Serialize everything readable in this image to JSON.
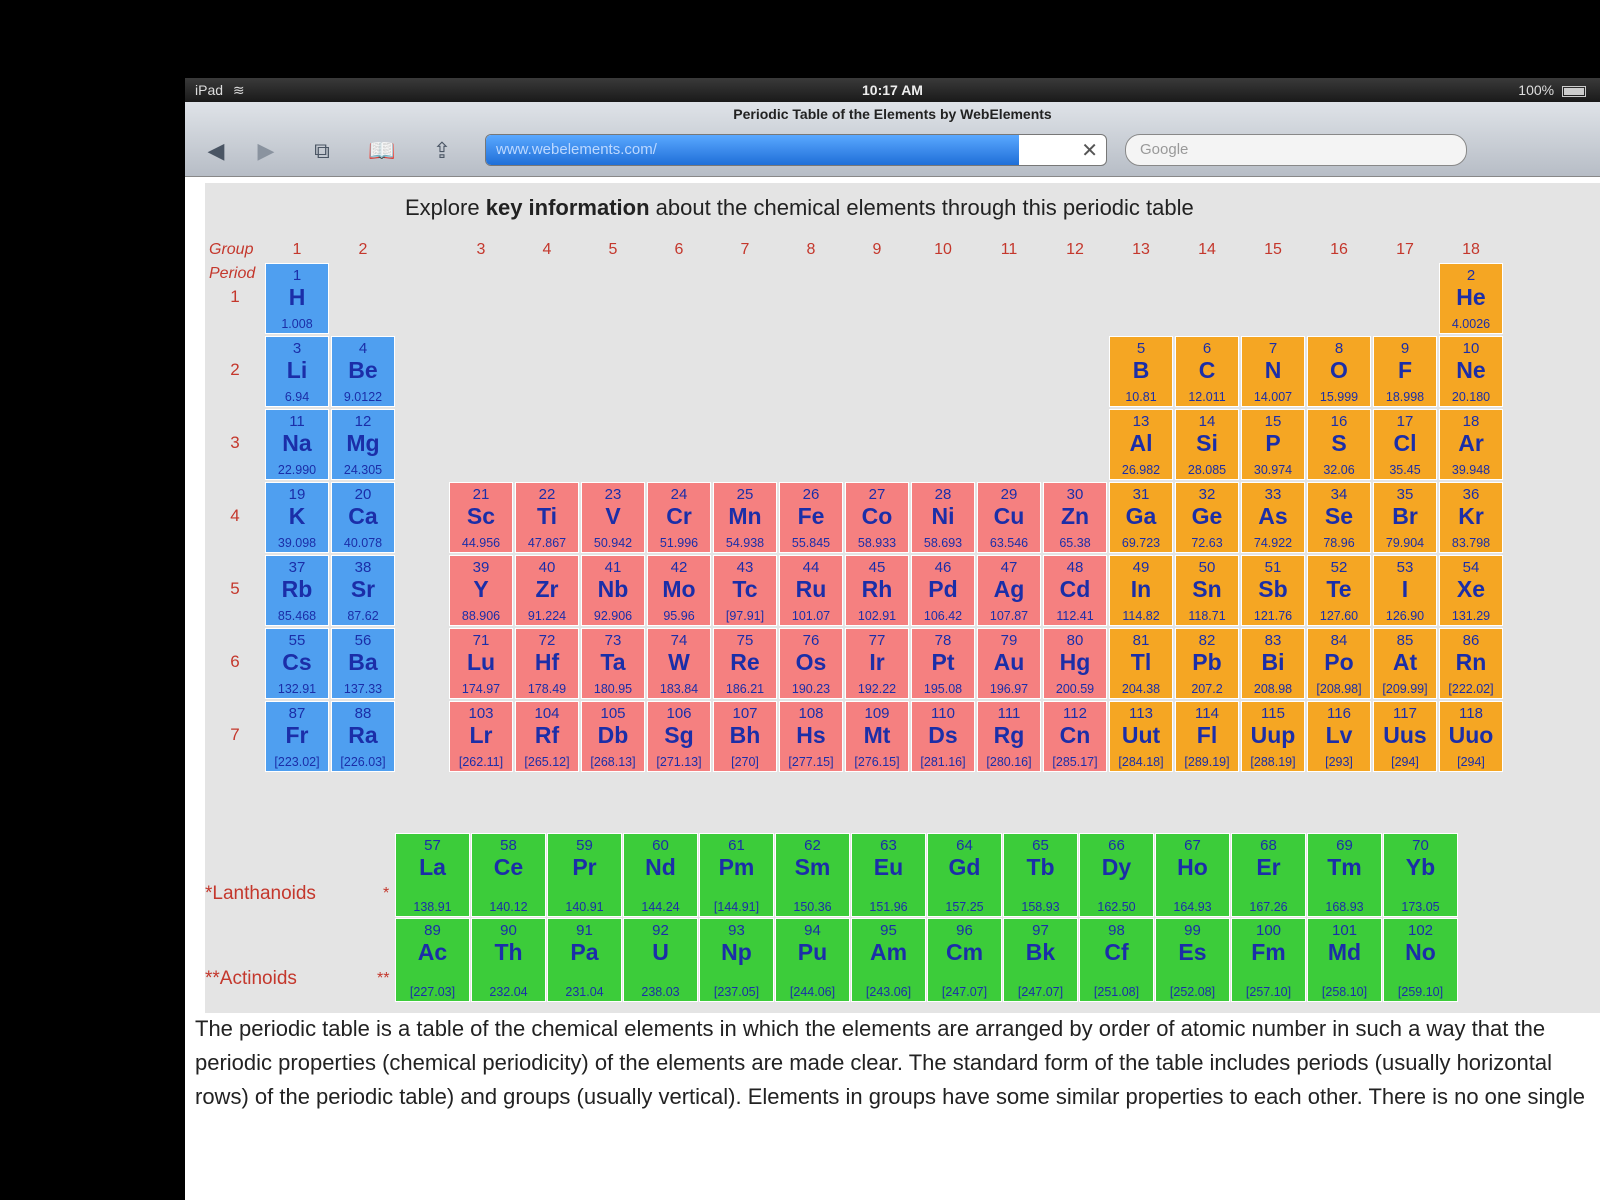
{
  "status_bar": {
    "device": "iPad",
    "time": "10:17 AM",
    "battery": "100%"
  },
  "browser": {
    "page_title": "Periodic Table of the Elements by WebElements",
    "url": "www.webelements.com/",
    "search_placeholder": "Google",
    "icons": [
      "back-icon",
      "forward-icon",
      "tabs-icon",
      "bookmarks-icon",
      "share-icon",
      "close-icon"
    ]
  },
  "page": {
    "headline_pre": "Explore ",
    "headline_bold": "key information",
    "headline_post": " about the chemical elements through this periodic table",
    "group_label": "Group",
    "period_label": "Period",
    "groups": [
      "1",
      "2",
      "3",
      "4",
      "5",
      "6",
      "7",
      "8",
      "9",
      "10",
      "11",
      "12",
      "13",
      "14",
      "15",
      "16",
      "17",
      "18"
    ],
    "periods": [
      "1",
      "2",
      "3",
      "4",
      "5",
      "6",
      "7"
    ],
    "lanthanoids_label": "*Lanthanoids",
    "actinoids_label": "**Actinoids",
    "marker_lan": "*",
    "marker_act": "**",
    "description": "The periodic table is a table of the chemical elements in which the elements are arranged by order of atomic number in such a way that the periodic properties (chemical periodicity) of the elements are made clear. The standard form of the table includes periods (usually horizontal rows) of the periodic table) and groups (usually vertical). Elements in groups have some similar properties to each other. There is no one single"
  },
  "colors": {
    "s_block": "#4f9ff0",
    "d_block": "#f58080",
    "p_block": "#f5a623",
    "f_block": "#3ccc3a",
    "text": "#1b2ea8"
  },
  "elements": [
    {
      "n": "1",
      "s": "H",
      "m": "1.008",
      "g": 1,
      "p": 1,
      "c": "s"
    },
    {
      "n": "2",
      "s": "He",
      "m": "4.0026",
      "g": 18,
      "p": 1,
      "c": "p"
    },
    {
      "n": "3",
      "s": "Li",
      "m": "6.94",
      "g": 1,
      "p": 2,
      "c": "s"
    },
    {
      "n": "4",
      "s": "Be",
      "m": "9.0122",
      "g": 2,
      "p": 2,
      "c": "s"
    },
    {
      "n": "5",
      "s": "B",
      "m": "10.81",
      "g": 13,
      "p": 2,
      "c": "p"
    },
    {
      "n": "6",
      "s": "C",
      "m": "12.011",
      "g": 14,
      "p": 2,
      "c": "p"
    },
    {
      "n": "7",
      "s": "N",
      "m": "14.007",
      "g": 15,
      "p": 2,
      "c": "p"
    },
    {
      "n": "8",
      "s": "O",
      "m": "15.999",
      "g": 16,
      "p": 2,
      "c": "p"
    },
    {
      "n": "9",
      "s": "F",
      "m": "18.998",
      "g": 17,
      "p": 2,
      "c": "p"
    },
    {
      "n": "10",
      "s": "Ne",
      "m": "20.180",
      "g": 18,
      "p": 2,
      "c": "p"
    },
    {
      "n": "11",
      "s": "Na",
      "m": "22.990",
      "g": 1,
      "p": 3,
      "c": "s"
    },
    {
      "n": "12",
      "s": "Mg",
      "m": "24.305",
      "g": 2,
      "p": 3,
      "c": "s"
    },
    {
      "n": "13",
      "s": "Al",
      "m": "26.982",
      "g": 13,
      "p": 3,
      "c": "p"
    },
    {
      "n": "14",
      "s": "Si",
      "m": "28.085",
      "g": 14,
      "p": 3,
      "c": "p"
    },
    {
      "n": "15",
      "s": "P",
      "m": "30.974",
      "g": 15,
      "p": 3,
      "c": "p"
    },
    {
      "n": "16",
      "s": "S",
      "m": "32.06",
      "g": 16,
      "p": 3,
      "c": "p"
    },
    {
      "n": "17",
      "s": "Cl",
      "m": "35.45",
      "g": 17,
      "p": 3,
      "c": "p"
    },
    {
      "n": "18",
      "s": "Ar",
      "m": "39.948",
      "g": 18,
      "p": 3,
      "c": "p"
    },
    {
      "n": "19",
      "s": "K",
      "m": "39.098",
      "g": 1,
      "p": 4,
      "c": "s"
    },
    {
      "n": "20",
      "s": "Ca",
      "m": "40.078",
      "g": 2,
      "p": 4,
      "c": "s"
    },
    {
      "n": "21",
      "s": "Sc",
      "m": "44.956",
      "g": 3,
      "p": 4,
      "c": "d"
    },
    {
      "n": "22",
      "s": "Ti",
      "m": "47.867",
      "g": 4,
      "p": 4,
      "c": "d"
    },
    {
      "n": "23",
      "s": "V",
      "m": "50.942",
      "g": 5,
      "p": 4,
      "c": "d"
    },
    {
      "n": "24",
      "s": "Cr",
      "m": "51.996",
      "g": 6,
      "p": 4,
      "c": "d"
    },
    {
      "n": "25",
      "s": "Mn",
      "m": "54.938",
      "g": 7,
      "p": 4,
      "c": "d"
    },
    {
      "n": "26",
      "s": "Fe",
      "m": "55.845",
      "g": 8,
      "p": 4,
      "c": "d"
    },
    {
      "n": "27",
      "s": "Co",
      "m": "58.933",
      "g": 9,
      "p": 4,
      "c": "d"
    },
    {
      "n": "28",
      "s": "Ni",
      "m": "58.693",
      "g": 10,
      "p": 4,
      "c": "d"
    },
    {
      "n": "29",
      "s": "Cu",
      "m": "63.546",
      "g": 11,
      "p": 4,
      "c": "d"
    },
    {
      "n": "30",
      "s": "Zn",
      "m": "65.38",
      "g": 12,
      "p": 4,
      "c": "d"
    },
    {
      "n": "31",
      "s": "Ga",
      "m": "69.723",
      "g": 13,
      "p": 4,
      "c": "p"
    },
    {
      "n": "32",
      "s": "Ge",
      "m": "72.63",
      "g": 14,
      "p": 4,
      "c": "p"
    },
    {
      "n": "33",
      "s": "As",
      "m": "74.922",
      "g": 15,
      "p": 4,
      "c": "p"
    },
    {
      "n": "34",
      "s": "Se",
      "m": "78.96",
      "g": 16,
      "p": 4,
      "c": "p"
    },
    {
      "n": "35",
      "s": "Br",
      "m": "79.904",
      "g": 17,
      "p": 4,
      "c": "p"
    },
    {
      "n": "36",
      "s": "Kr",
      "m": "83.798",
      "g": 18,
      "p": 4,
      "c": "p"
    },
    {
      "n": "37",
      "s": "Rb",
      "m": "85.468",
      "g": 1,
      "p": 5,
      "c": "s"
    },
    {
      "n": "38",
      "s": "Sr",
      "m": "87.62",
      "g": 2,
      "p": 5,
      "c": "s"
    },
    {
      "n": "39",
      "s": "Y",
      "m": "88.906",
      "g": 3,
      "p": 5,
      "c": "d"
    },
    {
      "n": "40",
      "s": "Zr",
      "m": "91.224",
      "g": 4,
      "p": 5,
      "c": "d"
    },
    {
      "n": "41",
      "s": "Nb",
      "m": "92.906",
      "g": 5,
      "p": 5,
      "c": "d"
    },
    {
      "n": "42",
      "s": "Mo",
      "m": "95.96",
      "g": 6,
      "p": 5,
      "c": "d"
    },
    {
      "n": "43",
      "s": "Tc",
      "m": "[97.91]",
      "g": 7,
      "p": 5,
      "c": "d"
    },
    {
      "n": "44",
      "s": "Ru",
      "m": "101.07",
      "g": 8,
      "p": 5,
      "c": "d"
    },
    {
      "n": "45",
      "s": "Rh",
      "m": "102.91",
      "g": 9,
      "p": 5,
      "c": "d"
    },
    {
      "n": "46",
      "s": "Pd",
      "m": "106.42",
      "g": 10,
      "p": 5,
      "c": "d"
    },
    {
      "n": "47",
      "s": "Ag",
      "m": "107.87",
      "g": 11,
      "p": 5,
      "c": "d"
    },
    {
      "n": "48",
      "s": "Cd",
      "m": "112.41",
      "g": 12,
      "p": 5,
      "c": "d"
    },
    {
      "n": "49",
      "s": "In",
      "m": "114.82",
      "g": 13,
      "p": 5,
      "c": "p"
    },
    {
      "n": "50",
      "s": "Sn",
      "m": "118.71",
      "g": 14,
      "p": 5,
      "c": "p"
    },
    {
      "n": "51",
      "s": "Sb",
      "m": "121.76",
      "g": 15,
      "p": 5,
      "c": "p"
    },
    {
      "n": "52",
      "s": "Te",
      "m": "127.60",
      "g": 16,
      "p": 5,
      "c": "p"
    },
    {
      "n": "53",
      "s": "I",
      "m": "126.90",
      "g": 17,
      "p": 5,
      "c": "p"
    },
    {
      "n": "54",
      "s": "Xe",
      "m": "131.29",
      "g": 18,
      "p": 5,
      "c": "p"
    },
    {
      "n": "55",
      "s": "Cs",
      "m": "132.91",
      "g": 1,
      "p": 6,
      "c": "s"
    },
    {
      "n": "56",
      "s": "Ba",
      "m": "137.33",
      "g": 2,
      "p": 6,
      "c": "s"
    },
    {
      "n": "71",
      "s": "Lu",
      "m": "174.97",
      "g": 3,
      "p": 6,
      "c": "d"
    },
    {
      "n": "72",
      "s": "Hf",
      "m": "178.49",
      "g": 4,
      "p": 6,
      "c": "d"
    },
    {
      "n": "73",
      "s": "Ta",
      "m": "180.95",
      "g": 5,
      "p": 6,
      "c": "d"
    },
    {
      "n": "74",
      "s": "W",
      "m": "183.84",
      "g": 6,
      "p": 6,
      "c": "d"
    },
    {
      "n": "75",
      "s": "Re",
      "m": "186.21",
      "g": 7,
      "p": 6,
      "c": "d"
    },
    {
      "n": "76",
      "s": "Os",
      "m": "190.23",
      "g": 8,
      "p": 6,
      "c": "d"
    },
    {
      "n": "77",
      "s": "Ir",
      "m": "192.22",
      "g": 9,
      "p": 6,
      "c": "d"
    },
    {
      "n": "78",
      "s": "Pt",
      "m": "195.08",
      "g": 10,
      "p": 6,
      "c": "d"
    },
    {
      "n": "79",
      "s": "Au",
      "m": "196.97",
      "g": 11,
      "p": 6,
      "c": "d"
    },
    {
      "n": "80",
      "s": "Hg",
      "m": "200.59",
      "g": 12,
      "p": 6,
      "c": "d"
    },
    {
      "n": "81",
      "s": "Tl",
      "m": "204.38",
      "g": 13,
      "p": 6,
      "c": "p"
    },
    {
      "n": "82",
      "s": "Pb",
      "m": "207.2",
      "g": 14,
      "p": 6,
      "c": "p"
    },
    {
      "n": "83",
      "s": "Bi",
      "m": "208.98",
      "g": 15,
      "p": 6,
      "c": "p"
    },
    {
      "n": "84",
      "s": "Po",
      "m": "[208.98]",
      "g": 16,
      "p": 6,
      "c": "p"
    },
    {
      "n": "85",
      "s": "At",
      "m": "[209.99]",
      "g": 17,
      "p": 6,
      "c": "p"
    },
    {
      "n": "86",
      "s": "Rn",
      "m": "[222.02]",
      "g": 18,
      "p": 6,
      "c": "p"
    },
    {
      "n": "87",
      "s": "Fr",
      "m": "[223.02]",
      "g": 1,
      "p": 7,
      "c": "s"
    },
    {
      "n": "88",
      "s": "Ra",
      "m": "[226.03]",
      "g": 2,
      "p": 7,
      "c": "s"
    },
    {
      "n": "103",
      "s": "Lr",
      "m": "[262.11]",
      "g": 3,
      "p": 7,
      "c": "d"
    },
    {
      "n": "104",
      "s": "Rf",
      "m": "[265.12]",
      "g": 4,
      "p": 7,
      "c": "d"
    },
    {
      "n": "105",
      "s": "Db",
      "m": "[268.13]",
      "g": 5,
      "p": 7,
      "c": "d"
    },
    {
      "n": "106",
      "s": "Sg",
      "m": "[271.13]",
      "g": 6,
      "p": 7,
      "c": "d"
    },
    {
      "n": "107",
      "s": "Bh",
      "m": "[270]",
      "g": 7,
      "p": 7,
      "c": "d"
    },
    {
      "n": "108",
      "s": "Hs",
      "m": "[277.15]",
      "g": 8,
      "p": 7,
      "c": "d"
    },
    {
      "n": "109",
      "s": "Mt",
      "m": "[276.15]",
      "g": 9,
      "p": 7,
      "c": "d"
    },
    {
      "n": "110",
      "s": "Ds",
      "m": "[281.16]",
      "g": 10,
      "p": 7,
      "c": "d"
    },
    {
      "n": "111",
      "s": "Rg",
      "m": "[280.16]",
      "g": 11,
      "p": 7,
      "c": "d"
    },
    {
      "n": "112",
      "s": "Cn",
      "m": "[285.17]",
      "g": 12,
      "p": 7,
      "c": "d"
    },
    {
      "n": "113",
      "s": "Uut",
      "m": "[284.18]",
      "g": 13,
      "p": 7,
      "c": "p"
    },
    {
      "n": "114",
      "s": "Fl",
      "m": "[289.19]",
      "g": 14,
      "p": 7,
      "c": "p"
    },
    {
      "n": "115",
      "s": "Uup",
      "m": "[288.19]",
      "g": 15,
      "p": 7,
      "c": "p"
    },
    {
      "n": "116",
      "s": "Lv",
      "m": "[293]",
      "g": 16,
      "p": 7,
      "c": "p"
    },
    {
      "n": "117",
      "s": "Uus",
      "m": "[294]",
      "g": 17,
      "p": 7,
      "c": "p"
    },
    {
      "n": "118",
      "s": "Uuo",
      "m": "[294]",
      "g": 18,
      "p": 7,
      "c": "p"
    }
  ],
  "lanthanoids": [
    {
      "n": "57",
      "s": "La",
      "m": "138.91"
    },
    {
      "n": "58",
      "s": "Ce",
      "m": "140.12"
    },
    {
      "n": "59",
      "s": "Pr",
      "m": "140.91"
    },
    {
      "n": "60",
      "s": "Nd",
      "m": "144.24"
    },
    {
      "n": "61",
      "s": "Pm",
      "m": "[144.91]"
    },
    {
      "n": "62",
      "s": "Sm",
      "m": "150.36"
    },
    {
      "n": "63",
      "s": "Eu",
      "m": "151.96"
    },
    {
      "n": "64",
      "s": "Gd",
      "m": "157.25"
    },
    {
      "n": "65",
      "s": "Tb",
      "m": "158.93"
    },
    {
      "n": "66",
      "s": "Dy",
      "m": "162.50"
    },
    {
      "n": "67",
      "s": "Ho",
      "m": "164.93"
    },
    {
      "n": "68",
      "s": "Er",
      "m": "167.26"
    },
    {
      "n": "69",
      "s": "Tm",
      "m": "168.93"
    },
    {
      "n": "70",
      "s": "Yb",
      "m": "173.05"
    }
  ],
  "actinoids": [
    {
      "n": "89",
      "s": "Ac",
      "m": "[227.03]"
    },
    {
      "n": "90",
      "s": "Th",
      "m": "232.04"
    },
    {
      "n": "91",
      "s": "Pa",
      "m": "231.04"
    },
    {
      "n": "92",
      "s": "U",
      "m": "238.03"
    },
    {
      "n": "93",
      "s": "Np",
      "m": "[237.05]"
    },
    {
      "n": "94",
      "s": "Pu",
      "m": "[244.06]"
    },
    {
      "n": "95",
      "s": "Am",
      "m": "[243.06]"
    },
    {
      "n": "96",
      "s": "Cm",
      "m": "[247.07]"
    },
    {
      "n": "97",
      "s": "Bk",
      "m": "[247.07]"
    },
    {
      "n": "98",
      "s": "Cf",
      "m": "[251.08]"
    },
    {
      "n": "99",
      "s": "Es",
      "m": "[252.08]"
    },
    {
      "n": "100",
      "s": "Fm",
      "m": "[257.10]"
    },
    {
      "n": "101",
      "s": "Md",
      "m": "[258.10]"
    },
    {
      "n": "102",
      "s": "No",
      "m": "[259.10]"
    }
  ]
}
